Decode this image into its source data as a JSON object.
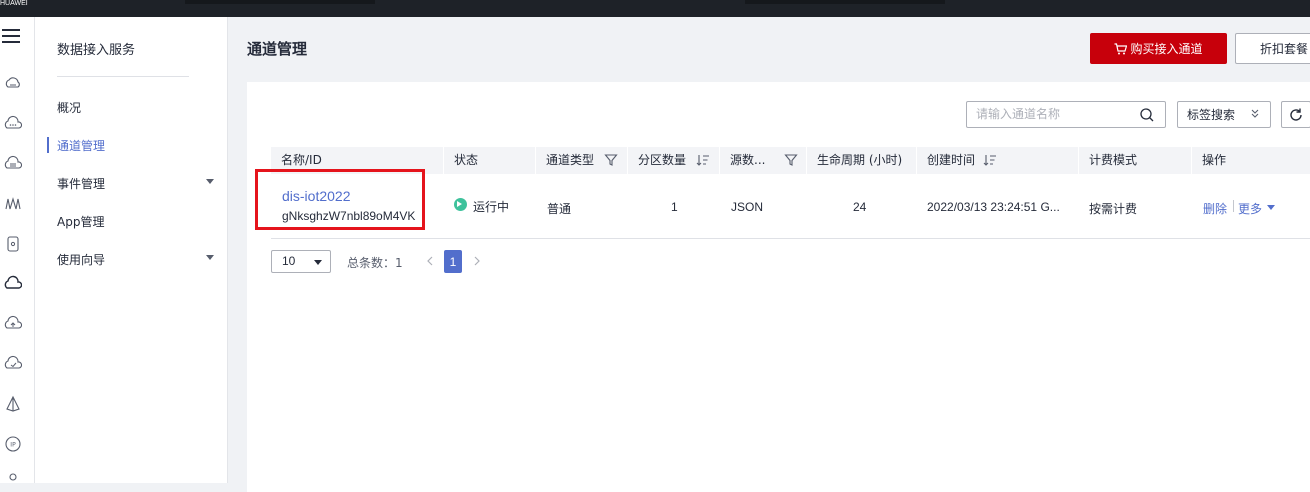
{
  "topbar": {
    "brand": "HUAWEI"
  },
  "sidenav": {
    "title": "数据接入服务",
    "items": [
      {
        "label": "概况",
        "active": false,
        "expandable": false
      },
      {
        "label": "通道管理",
        "active": true,
        "expandable": false
      },
      {
        "label": "事件管理",
        "active": false,
        "expandable": true
      },
      {
        "label": "App管理",
        "active": false,
        "expandable": false
      },
      {
        "label": "使用向导",
        "active": false,
        "expandable": true
      }
    ]
  },
  "header": {
    "title": "通道管理",
    "buy_label": "购买接入通道",
    "discount_label": "折扣套餐"
  },
  "toolbar": {
    "search_placeholder": "请输入通道名称",
    "tag_search_label": "标签搜索"
  },
  "table": {
    "columns": [
      "名称/ID",
      "状态",
      "通道类型",
      "分区数量",
      "源数...",
      "生命周期 (小时)",
      "创建时间",
      "计费模式",
      "操作"
    ],
    "rows": [
      {
        "name": "dis-iot2022",
        "id": "gNksghzW7nbl89oM4VK",
        "status": "运行中",
        "type": "普通",
        "partitions": "1",
        "source": "JSON",
        "lifecycle": "24",
        "created": "2022/03/13 23:24:51 G...",
        "billing": "按需计费",
        "op_delete": "删除",
        "op_more": "更多"
      }
    ]
  },
  "pagination": {
    "page_size": "10",
    "total_label": "总条数：1",
    "current_page": "1"
  },
  "colors": {
    "accent": "#526ecc",
    "brand_red": "#c7000b",
    "highlight": "#e5141c",
    "status_running": "#3ec29c"
  }
}
